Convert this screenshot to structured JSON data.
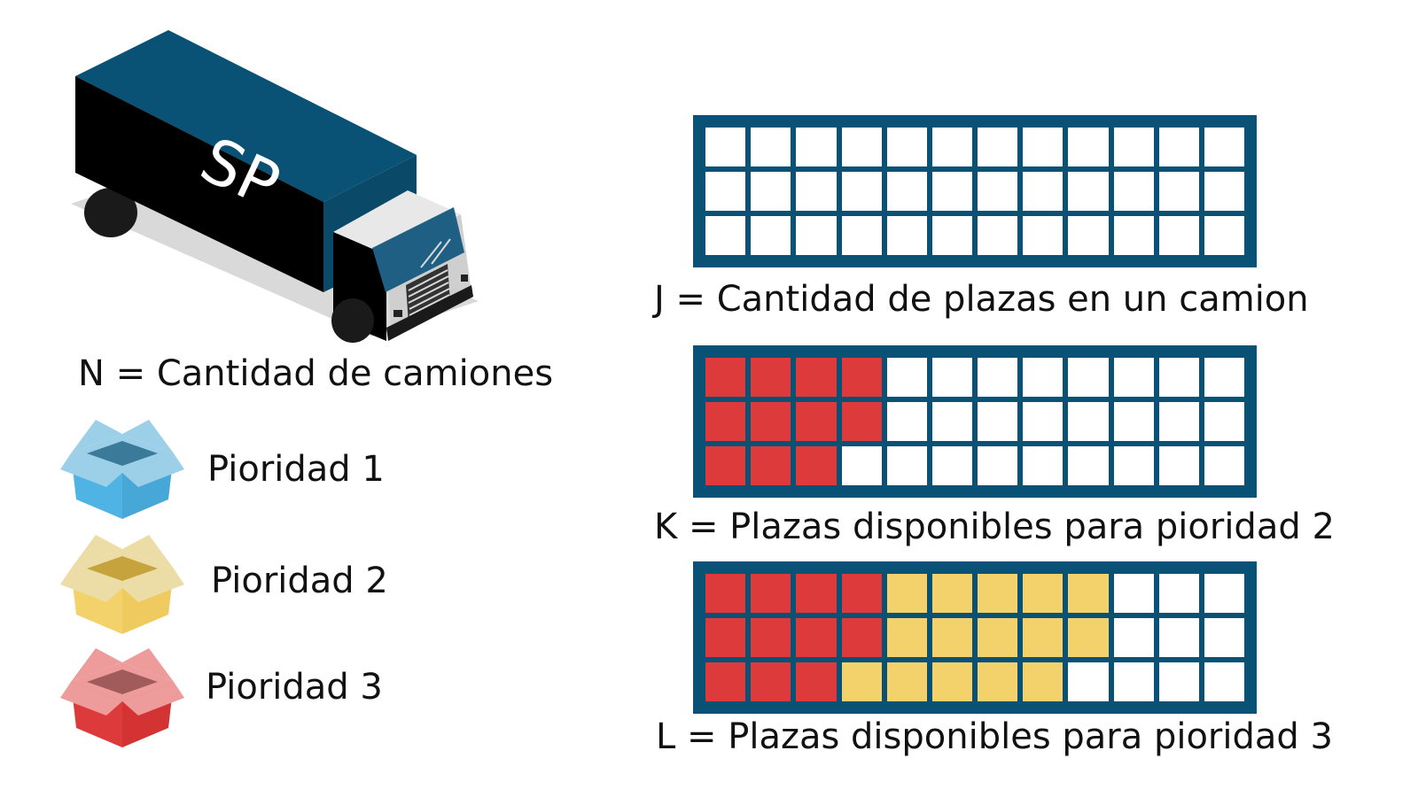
{
  "truck": {
    "logo_text": "SP"
  },
  "labels": {
    "n": "N = Cantidad de camiones",
    "j": "J = Cantidad de plazas en un camion",
    "k": "K = Plazas disponibles para pioridad 2",
    "l": "L = Plazas disponibles para pioridad 3"
  },
  "priorities": [
    {
      "label": "Pioridad 1",
      "color": "#4fb3e3",
      "light": "#9ccfe8",
      "dark": "#3b7a99"
    },
    {
      "label": "Pioridad 2",
      "color": "#f3d26b",
      "light": "#ecdca6",
      "dark": "#c6a33c"
    },
    {
      "label": "Pioridad 3",
      "color": "#dd3b3b",
      "light": "#ee9b9b",
      "dark": "#a25b5b"
    }
  ],
  "colors": {
    "grid_frame": "#0a5275",
    "empty": "#ffffff",
    "priority3_fill": "#dd3b3b",
    "priority2_fill": "#f3d26b"
  },
  "grids": {
    "columns": 12,
    "rows": 3,
    "j": {
      "red": 0,
      "yellow": 0
    },
    "k": {
      "red": 11,
      "yellow": 0
    },
    "l": {
      "red": 11,
      "yellow": 15
    }
  }
}
